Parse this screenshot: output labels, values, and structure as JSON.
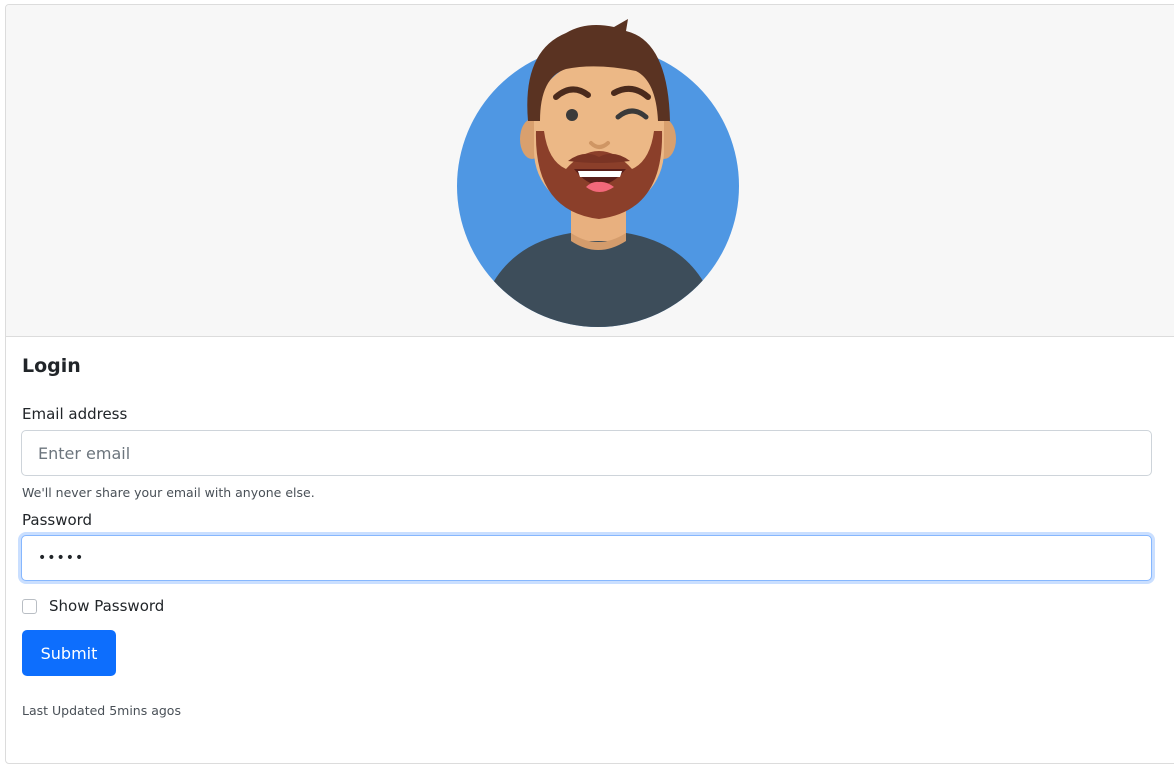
{
  "header": {
    "avatar_icon": "winking-bearded-man-avatar",
    "avatar_bg": "#4f97e3"
  },
  "form": {
    "title": "Login",
    "email_label": "Email address",
    "email_placeholder": "Enter email",
    "email_value": "",
    "email_help": "We'll never share your email with anyone else.",
    "password_label": "Password",
    "password_value": "•••••",
    "show_password_label": "Show Password",
    "show_password_checked": false,
    "submit_label": "Submit",
    "submit_color": "#0d6efd"
  },
  "footer": {
    "last_updated": "Last Updated 5mins agos"
  }
}
